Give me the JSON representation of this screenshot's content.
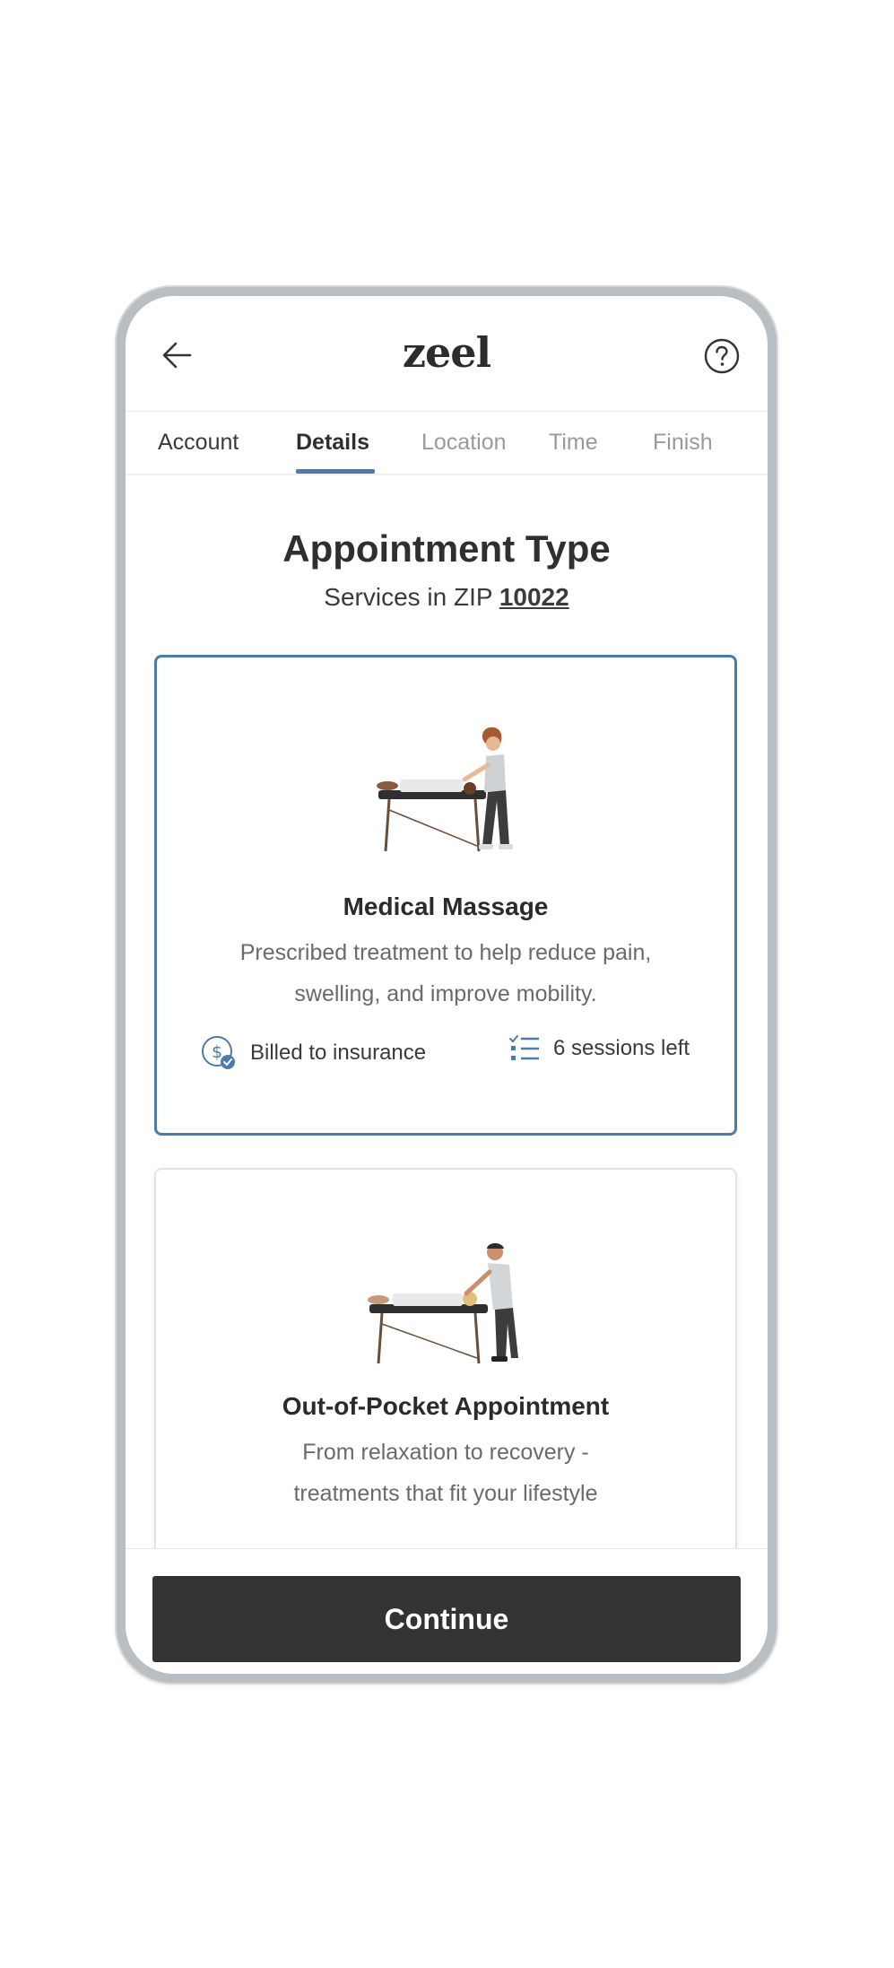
{
  "header": {
    "logo": "zeel"
  },
  "tabs": [
    {
      "label": "Account"
    },
    {
      "label": "Details"
    },
    {
      "label": "Location"
    },
    {
      "label": "Time"
    },
    {
      "label": "Finish"
    }
  ],
  "page": {
    "title": "Appointment Type",
    "subtitle_prefix": "Services in ZIP ",
    "zip": "10022"
  },
  "cards": [
    {
      "title": "Medical Massage",
      "description_line1": "Prescribed treatment to help reduce pain,",
      "description_line2": "swelling, and improve mobility.",
      "billing": "Billed to insurance",
      "sessions": "6 sessions left",
      "selected": true
    },
    {
      "title": "Out-of-Pocket Appointment",
      "description_line1": "From relaxation to recovery -",
      "description_line2": "treatments that fit your lifestyle",
      "selected": false
    }
  ],
  "footer": {
    "continue_label": "Continue"
  },
  "icons": {
    "back": "arrow-left-icon",
    "help": "question-circle-icon",
    "billing": "dollar-check-icon",
    "sessions": "checklist-icon"
  },
  "colors": {
    "accent": "#4c7ba8",
    "button": "#333333",
    "text": "#2f2f2f",
    "muted": "#9a9a9a"
  }
}
